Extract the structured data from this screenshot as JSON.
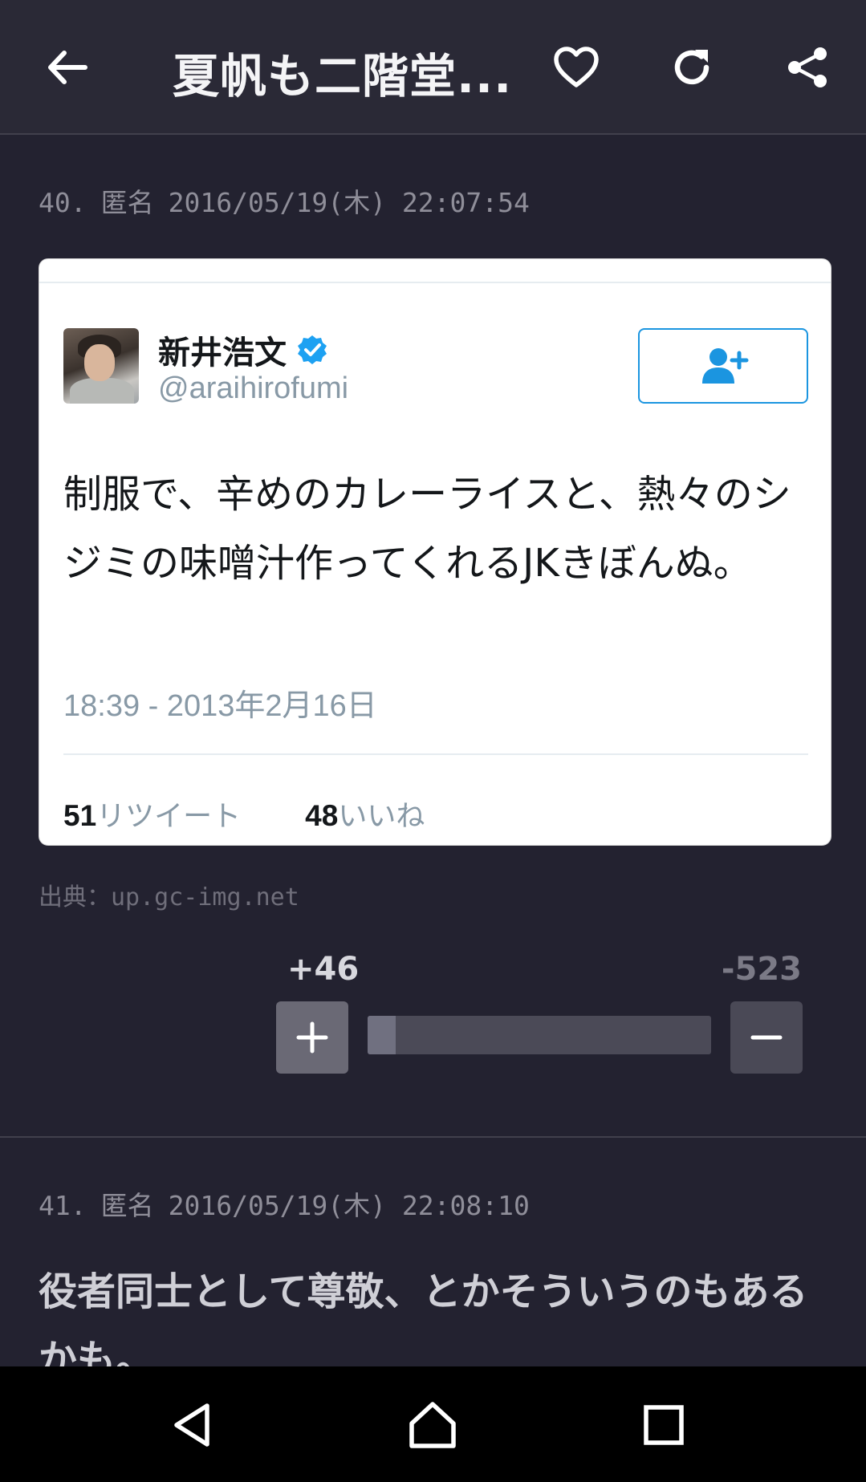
{
  "appbar": {
    "title": "夏帆も二階堂...",
    "icons": [
      "back-arrow-icon",
      "heart-icon",
      "reload-icon",
      "share-icon"
    ]
  },
  "comment40": {
    "number": "40.",
    "author": "匿名",
    "datetime": "2016/05/19(木) 22:07:54"
  },
  "tweet": {
    "display_name": "新井浩文",
    "handle": "@araihirofumi",
    "text": "制服で、辛めのカレーライスと、熱々のシジミの味噌汁作ってくれるJKきぼんぬ。",
    "timestamp": "18:39 - 2013年2月16日",
    "retweets": "51",
    "retweets_label": "リツイート",
    "likes": "48",
    "likes_label": "いいね",
    "accent_color": "#1b95e0"
  },
  "source": "出典：up.gc-img.net",
  "vote": {
    "plus_count": "+46",
    "minus_count": "-523",
    "plus_fraction": 0.081
  },
  "comment41": {
    "number": "41.",
    "author": "匿名",
    "datetime": "2016/05/19(木) 22:08:10",
    "body": "役者同士として尊敬、とかそういうのもあるかも。"
  },
  "colors": {
    "background": "#232230",
    "appbar": "#2a2936",
    "card": "#ffffff"
  }
}
